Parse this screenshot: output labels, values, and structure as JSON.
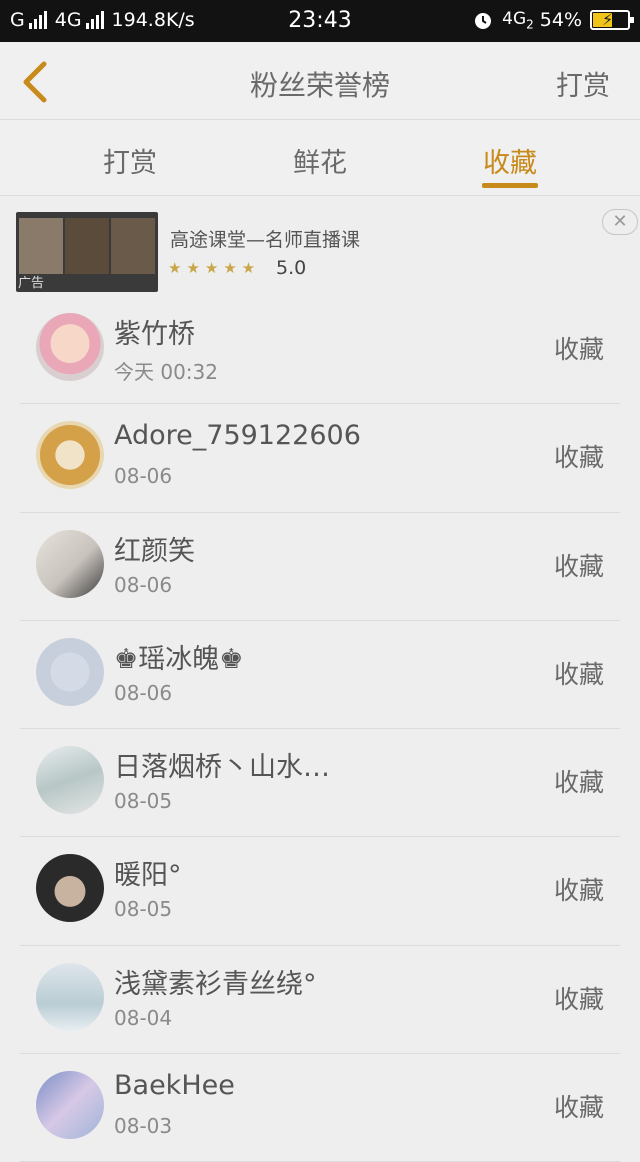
{
  "status": {
    "carrier": "G",
    "network": "4G",
    "speed": "194.8K/s",
    "time": "23:43",
    "network2": "4G",
    "network2_sub": "2",
    "battery_text": "54%",
    "battery_level": 0.54
  },
  "nav": {
    "title": "粉丝荣誉榜",
    "action": "打赏"
  },
  "tabs": [
    {
      "label": "打赏"
    },
    {
      "label": "鲜花"
    },
    {
      "label": "收藏",
      "active": true
    }
  ],
  "ad": {
    "title": "高途课堂—名师直播课",
    "rating": "5.0",
    "stars": "★★★★★",
    "label": "广告",
    "close": "✕"
  },
  "list": [
    {
      "name": "紫竹桥",
      "date": "今天 00:32",
      "action": "收藏",
      "avatar_icon": "anime-girl-avatar"
    },
    {
      "name": "Adore_759122606",
      "date": "08-06",
      "action": "收藏",
      "avatar_icon": "tfboys-logo-avatar"
    },
    {
      "name": "红颜笑",
      "date": "08-06",
      "action": "收藏",
      "avatar_icon": "portrait-avatar"
    },
    {
      "name": "♚瑶冰魄♚",
      "date": "08-06",
      "action": "收藏",
      "avatar_icon": "default-z-avatar"
    },
    {
      "name": "日落烟桥丶山水…",
      "date": "08-05",
      "action": "收藏",
      "avatar_icon": "costume-girl-avatar"
    },
    {
      "name": "暖阳°",
      "date": "08-05",
      "action": "收藏",
      "avatar_icon": "portrait-avatar"
    },
    {
      "name": "浅黛素衫青丝绕°",
      "date": "08-04",
      "action": "收藏",
      "avatar_icon": "text-art-avatar"
    },
    {
      "name": "BaekHee",
      "date": "08-03",
      "action": "收藏",
      "avatar_icon": "anime-avatar"
    }
  ],
  "colors": {
    "accent": "#c88a1a",
    "background": "#eeeeee"
  }
}
